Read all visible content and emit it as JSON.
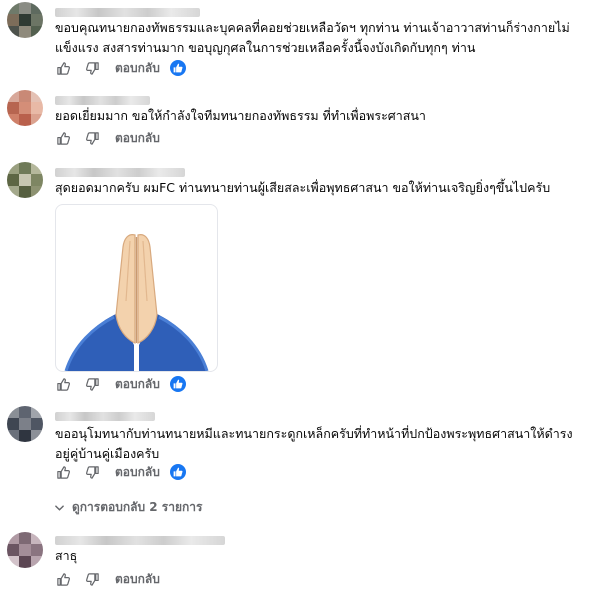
{
  "comments": [
    {
      "id": "c1",
      "text_lines": [
        "ขอบคุณทนายกองทัพธรรมและบุคคลที่คอยช่วยเหลือวัดฯ ทุกท่าน ท่านเจ้าอาวาสท่านก็ร่างกายไม่",
        "แข็งแรง สงสารท่านมาก ขอบุญกุศลในการช่วยเหลือครั้งนี้จงบังเกิดกับทุกๆ ท่าน"
      ],
      "reply_label": "ตอบกลับ",
      "has_like": true
    },
    {
      "id": "c2",
      "text_lines": [
        "ยอดเยี่ยมมาก ขอให้กำลังใจทีมทนายกองทัพธรรม ที่ทำเพื่อพระศาสนา"
      ],
      "reply_label": "ตอบกลับ",
      "has_like": false
    },
    {
      "id": "c3",
      "text_lines": [
        "สุดยอดมากครับ ผมFC ท่านทนายท่านผู้เสียสละเพื่อพุทธศาสนา ขอให้ท่านเจริญยิ่งๆขึ้นไปครับ"
      ],
      "reply_label": "ตอบกลับ",
      "has_like": true,
      "attachment": "folded-hands-emoji"
    },
    {
      "id": "c4",
      "text_lines": [
        "ขออนุโมทนากับท่านทนายหมีและทนายกระดูกเหล็กครับที่ทำหน้าที่ปกป้องพระพุทธศาสนาให้ดำรง",
        "อยู่คู่บ้านคู่เมืองครับ"
      ],
      "reply_label": "ตอบกลับ",
      "has_like": true,
      "view_replies": "ดูการตอบกลับ 2 รายการ"
    },
    {
      "id": "c5",
      "text_lines": [
        "สาธุ"
      ],
      "reply_label": "ตอบกลับ",
      "has_like": false
    }
  ],
  "icons": {
    "like": "thumbs-up-icon",
    "dislike": "thumbs-down-icon",
    "reaction": "like-reaction-icon",
    "expand": "chevron-down-icon"
  },
  "colors": {
    "text": "#050505",
    "secondary": "#65676b",
    "accent": "#1877f2"
  }
}
